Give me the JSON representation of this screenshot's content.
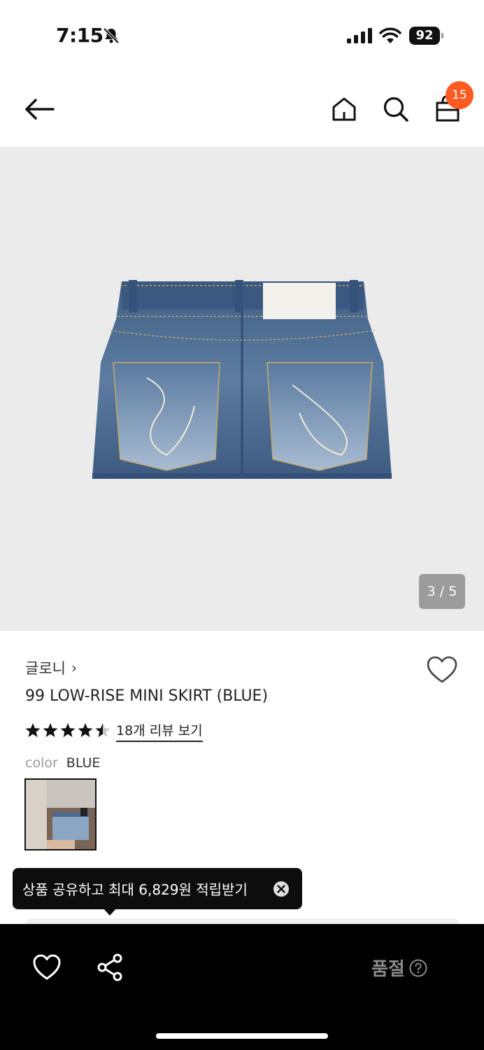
{
  "status_bar": {
    "time": "7:15",
    "battery": "92"
  },
  "header": {
    "cart_count": "15"
  },
  "gallery": {
    "counter": "3 / 5"
  },
  "product": {
    "brand": "글로니",
    "brand_chevron": "›",
    "title": "99 LOW-RISE MINI SKIRT (BLUE)",
    "rating": 4.5,
    "review_link": "18개 리뷰 보기",
    "color_label": "color",
    "color_value": "BLUE"
  },
  "tooltip": {
    "text": "상품 공유하고 최대 6,829원 적립받기"
  },
  "bottom_bar": {
    "status": "품절"
  },
  "colors": {
    "badge": "#ff5a1f",
    "bottom_bar": "#000000",
    "image_bg": "#ebebeb"
  },
  "icons": [
    "bell-off-icon",
    "signal-icon",
    "wifi-icon",
    "battery-icon",
    "back-arrow-icon",
    "home-icon",
    "search-icon",
    "shopping-bag-icon",
    "heart-icon",
    "star-icon",
    "close-icon",
    "share-icon",
    "help-icon"
  ]
}
